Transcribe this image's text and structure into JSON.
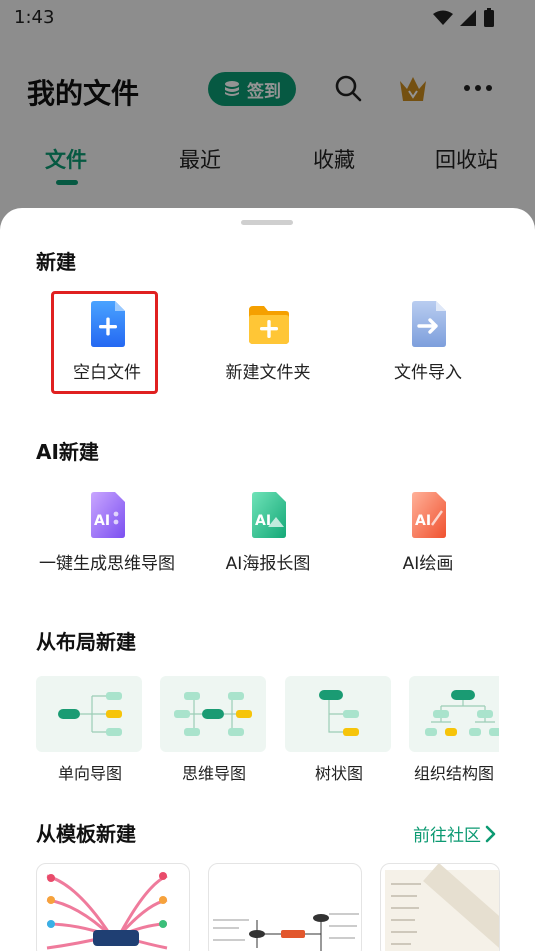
{
  "status": {
    "time": "1:43"
  },
  "header": {
    "title": "我的文件",
    "signin_label": "签到"
  },
  "tabs": [
    {
      "label": "文件",
      "active": true
    },
    {
      "label": "最近",
      "active": false
    },
    {
      "label": "收藏",
      "active": false
    },
    {
      "label": "回收站",
      "active": false
    }
  ],
  "sheet": {
    "new": {
      "title": "新建",
      "items": [
        {
          "label": "空白文件",
          "icon": "blank-file-icon"
        },
        {
          "label": "新建文件夹",
          "icon": "new-folder-icon"
        },
        {
          "label": "文件导入",
          "icon": "import-file-icon"
        }
      ]
    },
    "ai": {
      "title": "AI新建",
      "items": [
        {
          "label": "一键生成思维导图",
          "icon": "ai-mindmap-icon",
          "badge": "AI"
        },
        {
          "label": "AI海报长图",
          "icon": "ai-poster-icon",
          "badge": "AI"
        },
        {
          "label": "AI绘画",
          "icon": "ai-painting-icon",
          "badge": "AI"
        }
      ]
    },
    "layout": {
      "title": "从布局新建",
      "items": [
        {
          "label": "单向导图"
        },
        {
          "label": "思维导图"
        },
        {
          "label": "树状图"
        },
        {
          "label": "组织结构图"
        }
      ]
    },
    "template": {
      "title": "从模板新建",
      "link": "前往社区"
    }
  },
  "colors": {
    "accent": "#0c9a72",
    "highlight": "#e02020"
  }
}
